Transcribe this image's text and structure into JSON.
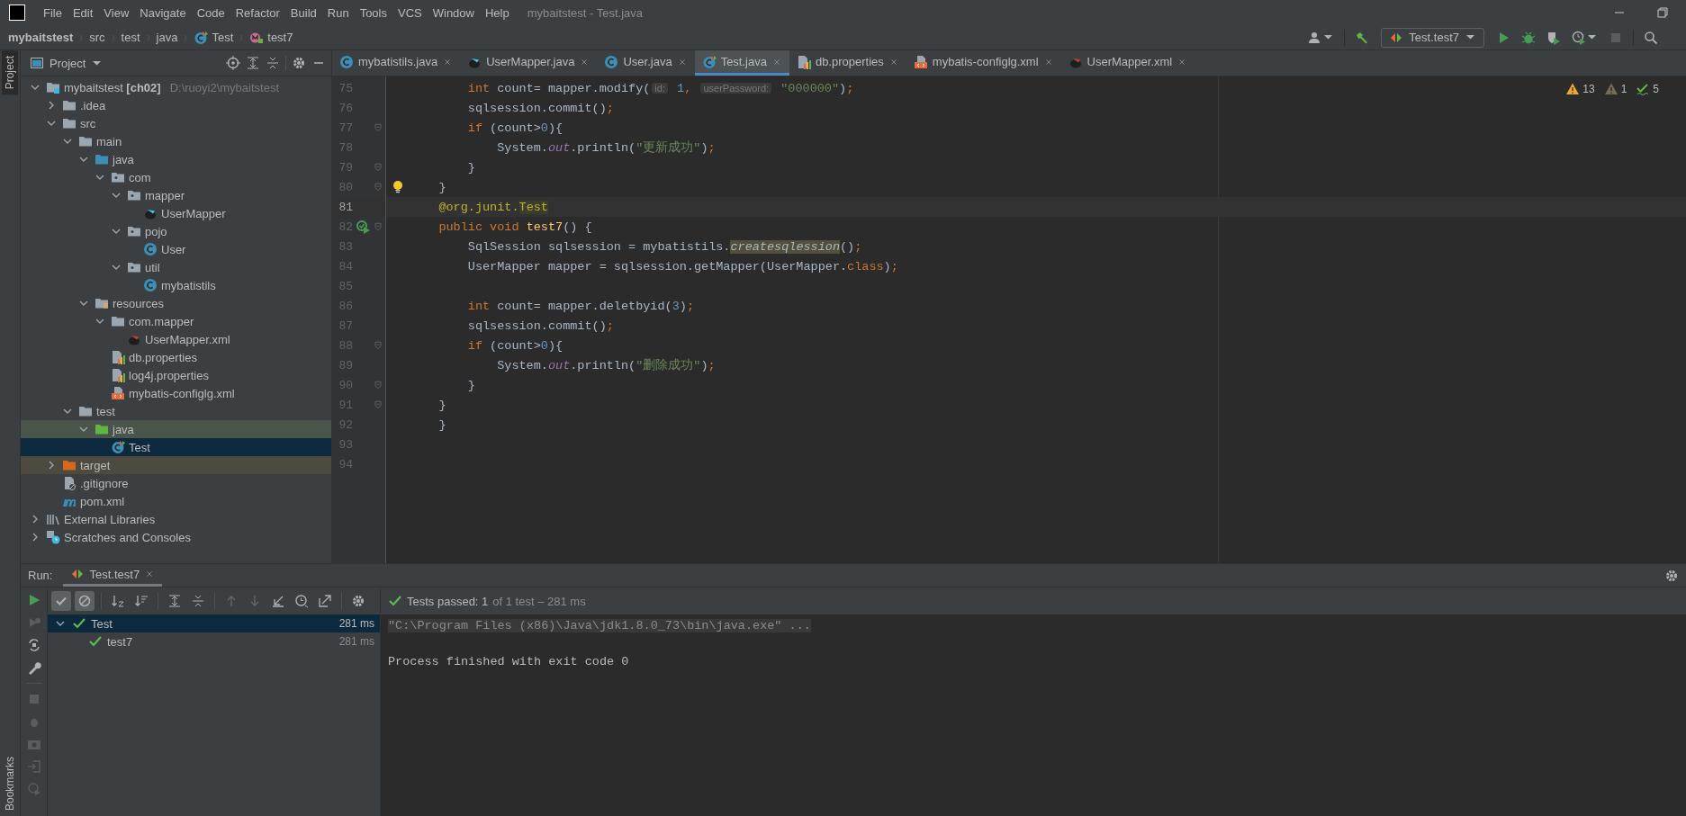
{
  "window": {
    "title": "mybaitstest - Test.java"
  },
  "menu": [
    "File",
    "Edit",
    "View",
    "Navigate",
    "Code",
    "Refactor",
    "Build",
    "Run",
    "Tools",
    "VCS",
    "Window",
    "Help"
  ],
  "breadcrumbs": [
    {
      "label": "mybaitstest",
      "kind": "project"
    },
    {
      "label": "src",
      "kind": "dir"
    },
    {
      "label": "test",
      "kind": "dir"
    },
    {
      "label": "java",
      "kind": "dir"
    },
    {
      "label": "Test",
      "kind": "test-class"
    },
    {
      "label": "test7",
      "kind": "method"
    }
  ],
  "toolbar": {
    "run_config": "Test.test7"
  },
  "side_tabs": {
    "top": [
      {
        "label": "Project",
        "selected": true
      }
    ],
    "bottom": [
      {
        "label": "Bookmarks",
        "selected": false
      }
    ]
  },
  "project": {
    "title": "Project",
    "tree": [
      {
        "label": "mybaitstest **[ch02]**",
        "hint": "D:\\ruoyi2\\mybaitstest",
        "kind": "module",
        "expanded": true,
        "selected": false,
        "children": [
          {
            "label": ".idea",
            "kind": "folder",
            "expanded": false,
            "selected": false
          },
          {
            "label": "src",
            "kind": "folder",
            "expanded": true,
            "selected": false,
            "children": [
              {
                "label": "main",
                "kind": "folder",
                "expanded": true,
                "selected": false,
                "children": [
                  {
                    "label": "java",
                    "kind": "source",
                    "expanded": true,
                    "selected": false,
                    "children": [
                      {
                        "label": "com",
                        "kind": "package",
                        "expanded": true,
                        "selected": false,
                        "children": [
                          {
                            "label": "mapper",
                            "kind": "package",
                            "expanded": true,
                            "selected": false,
                            "children": [
                              {
                                "label": "UserMapper",
                                "kind": "mapper",
                                "selected": false
                              }
                            ]
                          },
                          {
                            "label": "pojo",
                            "kind": "package",
                            "expanded": true,
                            "selected": false,
                            "children": [
                              {
                                "label": "User",
                                "kind": "class",
                                "selected": false
                              }
                            ]
                          },
                          {
                            "label": "util",
                            "kind": "package",
                            "expanded": true,
                            "selected": false,
                            "children": [
                              {
                                "label": "mybatistils",
                                "kind": "class",
                                "selected": false
                              }
                            ]
                          }
                        ]
                      }
                    ]
                  },
                  {
                    "label": "resources",
                    "kind": "resources",
                    "expanded": true,
                    "selected": false,
                    "children": [
                      {
                        "label": "com.mapper",
                        "kind": "folder",
                        "expanded": true,
                        "selected": false,
                        "children": [
                          {
                            "label": "UserMapper.xml",
                            "kind": "mapper-xml",
                            "selected": false
                          }
                        ]
                      },
                      {
                        "label": "db.properties",
                        "kind": "properties",
                        "selected": false
                      },
                      {
                        "label": "log4j.properties",
                        "kind": "properties",
                        "selected": false
                      },
                      {
                        "label": "mybatis-configlg.xml",
                        "kind": "config-xml",
                        "selected": false
                      }
                    ]
                  }
                ]
              },
              {
                "label": "test",
                "kind": "folder",
                "expanded": true,
                "selected": false,
                "children": [
                  {
                    "label": "java",
                    "kind": "test-source",
                    "expanded": true,
                    "selected": false,
                    "children": [
                      {
                        "label": "Test",
                        "kind": "test-class",
                        "selected": true
                      }
                    ]
                  }
                ]
              }
            ]
          },
          {
            "label": "target",
            "kind": "excluded",
            "expanded": false,
            "selected": false
          },
          {
            "label": ".gitignore",
            "kind": "gitignore",
            "selected": false
          },
          {
            "label": "pom.xml",
            "kind": "pom",
            "selected": false
          }
        ]
      },
      {
        "label": "External Libraries",
        "kind": "libraries",
        "expanded": false,
        "selected": false
      },
      {
        "label": "Scratches and Consoles",
        "kind": "scratches",
        "expanded": false,
        "selected": false
      }
    ]
  },
  "editor": {
    "tabs": [
      {
        "label": "mybatistils.java",
        "kind": "class",
        "selected": false
      },
      {
        "label": "UserMapper.java",
        "kind": "mapper",
        "selected": false
      },
      {
        "label": "User.java",
        "kind": "class",
        "selected": false
      },
      {
        "label": "Test.java",
        "kind": "test-class",
        "selected": true
      },
      {
        "label": "db.properties",
        "kind": "properties",
        "selected": false
      },
      {
        "label": "mybatis-configlg.xml",
        "kind": "config-xml",
        "selected": false
      },
      {
        "label": "UserMapper.xml",
        "kind": "mapper-xml",
        "selected": false
      }
    ],
    "inspections": [
      {
        "kind": "warning",
        "count": "13"
      },
      {
        "kind": "weak",
        "count": "1"
      },
      {
        "kind": "typo",
        "count": "5"
      }
    ],
    "lines": [
      {
        "number": "75",
        "current": false,
        "fold": false,
        "code": [
          {
            "text": "        int",
            "kind": "kw"
          },
          {
            "text": " count= mapper.modify(",
            "kind": "plain"
          },
          {
            "text": "id:",
            "kind": "hint"
          },
          {
            "text": " 1",
            "kind": "num"
          },
          {
            "text": ", ",
            "kind": "kw"
          },
          {
            "text": "userPassword:",
            "kind": "hint"
          },
          {
            "text": " \"000000\"",
            "kind": "str"
          },
          {
            "text": ")",
            "kind": "plain"
          },
          {
            "text": ";",
            "kind": "kw"
          }
        ]
      },
      {
        "number": "76",
        "current": false,
        "fold": false,
        "code": [
          {
            "text": "        sqlsession.commit()",
            "kind": "plain"
          },
          {
            "text": ";",
            "kind": "kw"
          }
        ]
      },
      {
        "number": "77",
        "current": false,
        "fold": true,
        "code": [
          {
            "text": "        if",
            "kind": "kw"
          },
          {
            "text": " (count>",
            "kind": "plain"
          },
          {
            "text": "0",
            "kind": "num"
          },
          {
            "text": "){",
            "kind": "plain"
          }
        ]
      },
      {
        "number": "78",
        "current": false,
        "fold": false,
        "code": [
          {
            "text": "            System.",
            "kind": "plain"
          },
          {
            "text": "out",
            "kind": "field"
          },
          {
            "text": ".println(",
            "kind": "plain"
          },
          {
            "text": "\"更新成功\"",
            "kind": "str"
          },
          {
            "text": ")",
            "kind": "plain"
          },
          {
            "text": ";",
            "kind": "kw"
          }
        ]
      },
      {
        "number": "79",
        "current": false,
        "fold": true,
        "code": [
          {
            "text": "        }",
            "kind": "plain"
          }
        ]
      },
      {
        "number": "80",
        "current": false,
        "fold": true,
        "kind": "bulb",
        "code": [
          {
            "text": "    }",
            "kind": "plain"
          }
        ]
      },
      {
        "number": "81",
        "current": true,
        "fold": false,
        "code": [
          {
            "text": "    @org.junit.",
            "kind": "annot"
          },
          {
            "text": "Test",
            "kind": "annot-hl"
          }
        ]
      },
      {
        "number": "82",
        "current": false,
        "fold": true,
        "kind": "run",
        "code": [
          {
            "text": "    public void ",
            "kind": "kw"
          },
          {
            "text": "test7",
            "kind": "fn"
          },
          {
            "text": "() {",
            "kind": "plain"
          }
        ]
      },
      {
        "number": "83",
        "current": false,
        "fold": false,
        "code": [
          {
            "text": "        SqlSession sqlsession = mybatistils.",
            "kind": "plain"
          },
          {
            "text": "createsqlession",
            "kind": "static-warn"
          },
          {
            "text": "()",
            "kind": "plain"
          },
          {
            "text": ";",
            "kind": "kw"
          }
        ]
      },
      {
        "number": "84",
        "current": false,
        "fold": false,
        "code": [
          {
            "text": "        UserMapper mapper = sqlsession.getMapper(UserMapper.",
            "kind": "plain"
          },
          {
            "text": "class",
            "kind": "kw"
          },
          {
            "text": ")",
            "kind": "plain"
          },
          {
            "text": ";",
            "kind": "kw"
          }
        ]
      },
      {
        "number": "85",
        "current": false,
        "fold": false
      },
      {
        "number": "86",
        "current": false,
        "fold": false,
        "code": [
          {
            "text": "        int",
            "kind": "kw"
          },
          {
            "text": " count= mapper.deletbyid(",
            "kind": "plain"
          },
          {
            "text": "3",
            "kind": "num"
          },
          {
            "text": ")",
            "kind": "plain"
          },
          {
            "text": ";",
            "kind": "kw"
          }
        ]
      },
      {
        "number": "87",
        "current": false,
        "fold": false,
        "code": [
          {
            "text": "        sqlsession.commit()",
            "kind": "plain"
          },
          {
            "text": ";",
            "kind": "kw"
          }
        ]
      },
      {
        "number": "88",
        "current": false,
        "fold": true,
        "code": [
          {
            "text": "        if",
            "kind": "kw"
          },
          {
            "text": " (count>",
            "kind": "plain"
          },
          {
            "text": "0",
            "kind": "num"
          },
          {
            "text": "){",
            "kind": "plain"
          }
        ]
      },
      {
        "number": "89",
        "current": false,
        "fold": false,
        "code": [
          {
            "text": "            System.",
            "kind": "plain"
          },
          {
            "text": "out",
            "kind": "field"
          },
          {
            "text": ".println(",
            "kind": "plain"
          },
          {
            "text": "\"删除成功\"",
            "kind": "str"
          },
          {
            "text": ")",
            "kind": "plain"
          },
          {
            "text": ";",
            "kind": "kw"
          }
        ]
      },
      {
        "number": "90",
        "current": false,
        "fold": true,
        "code": [
          {
            "text": "        }",
            "kind": "plain"
          }
        ]
      },
      {
        "number": "91",
        "current": false,
        "fold": true,
        "code": [
          {
            "text": "    }",
            "kind": "plain"
          }
        ]
      },
      {
        "number": "92",
        "current": false,
        "fold": false,
        "code": [
          {
            "text": "    }",
            "kind": "plain"
          }
        ]
      },
      {
        "number": "93",
        "current": false,
        "fold": false
      },
      {
        "number": "94",
        "current": false,
        "fold": false
      }
    ]
  },
  "run": {
    "label": "Run:",
    "tab": {
      "label": "Test.test7",
      "selected": true
    },
    "toolbar": [
      {
        "kind": "passed",
        "on": true,
        "disabled": false
      },
      {
        "kind": "ignored",
        "on": true,
        "disabled": false
      },
      {
        "kind": "sort-alpha",
        "on": false,
        "disabled": false
      },
      {
        "kind": "sort-duration",
        "on": false,
        "disabled": false
      },
      {
        "kind": "expand",
        "on": false,
        "disabled": false
      },
      {
        "kind": "collapse",
        "on": false,
        "disabled": false
      },
      {
        "kind": "up",
        "on": false,
        "disabled": true
      },
      {
        "kind": "down",
        "on": false,
        "disabled": true
      },
      {
        "kind": "import",
        "on": false,
        "disabled": false
      },
      {
        "kind": "history",
        "on": false,
        "disabled": false
      },
      {
        "kind": "export",
        "on": false,
        "disabled": false
      },
      {
        "kind": "settings",
        "on": false,
        "disabled": false
      }
    ],
    "status": {
      "summary": "Tests passed: 1",
      "detail": "of 1 test – 281 ms"
    },
    "tree": [
      {
        "label": "Test",
        "time": "281 ms",
        "passed": true,
        "selected": true,
        "expanded": true,
        "children": [
          {
            "label": "test7",
            "time": "281 ms",
            "passed": true,
            "selected": false
          }
        ]
      }
    ],
    "console": [
      {
        "text": "\"C:\\Program Files (x86)\\Java\\jdk1.8.0_73\\bin\\java.exe\" ...",
        "kind": "command"
      },
      {
        "text": "Process finished with exit code 0",
        "kind": "output"
      }
    ]
  }
}
